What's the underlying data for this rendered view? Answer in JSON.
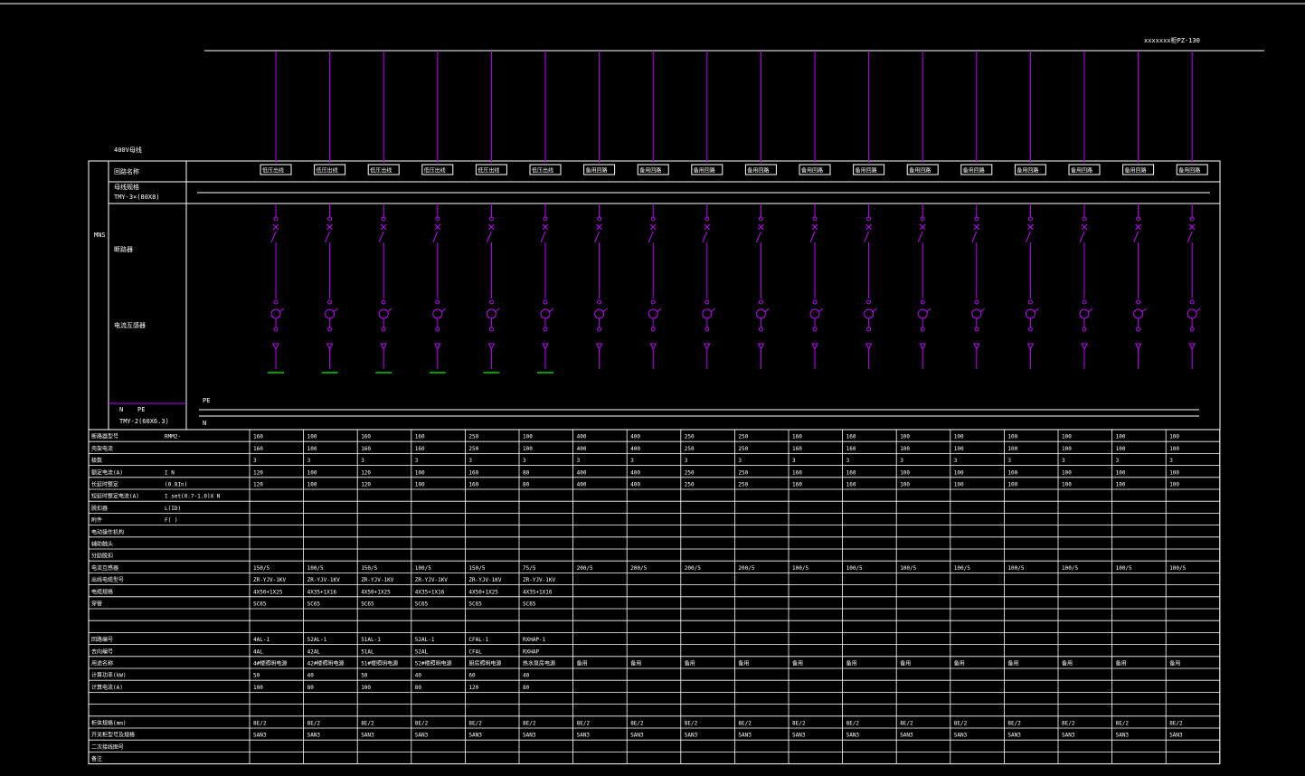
{
  "colors": {
    "background": "#000000",
    "lines": "#ffffff",
    "circuit": "#c000ff",
    "ground": "#00d000"
  },
  "header_note": "xxxxxxx柜PZ-130",
  "busbar_label": "400V母线",
  "left_panel": {
    "title_vertical": "MNS",
    "row_circuit_name": "回路名称",
    "row_busbar": "母线规格",
    "busbar_spec": "TMY-3×(80X8)",
    "row_breaker": "断路器",
    "row_ct": "电流互感器",
    "neutral_labels": [
      "N",
      "PE"
    ],
    "neutral_spec": "TMY-2(60X6.3)",
    "pe_label": "PE",
    "n_label": "N"
  },
  "feeders": [
    {
      "name": "低压出线",
      "rated": "160",
      "frame": "160",
      "poles": "3",
      "ir": "120",
      "set": "120",
      "ct": "150/5",
      "cable": "ZR-YJV-1KV",
      "size": "4X50+1X25",
      "conduit": "SC65",
      "loop": "4AL-1",
      "dest": "4AL",
      "use": "4#楼照明电源",
      "pe": "50",
      "ic": "100",
      "model": "8E/2",
      "stype": "SAN3",
      "ground": true
    },
    {
      "name": "低压出线",
      "rated": "100",
      "frame": "100",
      "poles": "3",
      "ir": "100",
      "set": "100",
      "ct": "100/5",
      "cable": "ZR-YJV-1KV",
      "size": "4X35+1X16",
      "conduit": "SC65",
      "loop": "52AL-1",
      "dest": "42AL",
      "use": "42#楼照明电源",
      "pe": "40",
      "ic": "80",
      "model": "8E/2",
      "stype": "SAN3",
      "ground": true
    },
    {
      "name": "低压出线",
      "rated": "160",
      "frame": "160",
      "poles": "3",
      "ir": "120",
      "set": "120",
      "ct": "150/5",
      "cable": "ZR-YJV-1KV",
      "size": "4X50+1X25",
      "conduit": "SC65",
      "loop": "51AL-1",
      "dest": "51AL",
      "use": "51#楼照明电源",
      "pe": "50",
      "ic": "100",
      "model": "8E/2",
      "stype": "SAN3",
      "ground": true
    },
    {
      "name": "低压出线",
      "rated": "160",
      "frame": "160",
      "poles": "3",
      "ir": "100",
      "set": "100",
      "ct": "100/5",
      "cable": "ZR-YJV-1KV",
      "size": "4X35+1X16",
      "conduit": "SC65",
      "loop": "52AL-1",
      "dest": "52AL",
      "use": "52#楼照明电源",
      "pe": "40",
      "ic": "80",
      "model": "8E/2",
      "stype": "SAN3",
      "ground": true
    },
    {
      "name": "低压出线",
      "rated": "250",
      "frame": "250",
      "poles": "3",
      "ir": "160",
      "set": "160",
      "ct": "150/5",
      "cable": "ZR-YJV-1KV",
      "size": "4X50+1X25",
      "conduit": "SC65",
      "loop": "CFAL-1",
      "dest": "CFAL",
      "use": "厨房照明电源",
      "pe": "60",
      "ic": "120",
      "model": "8E/2",
      "stype": "SAN3",
      "ground": true
    },
    {
      "name": "低压出线",
      "rated": "100",
      "frame": "100",
      "poles": "3",
      "ir": "80",
      "set": "80",
      "ct": "75/5",
      "cable": "ZR-YJV-1KV",
      "size": "4X35+1X16",
      "conduit": "SC65",
      "loop": "RXHAP-1",
      "dest": "RXHAP",
      "use": "热水泵房电源",
      "pe": "40",
      "ic": "80",
      "model": "8E/2",
      "stype": "SAN3",
      "ground": true
    },
    {
      "name": "备用回路",
      "rated": "400",
      "frame": "400",
      "poles": "3",
      "ir": "400",
      "set": "400",
      "ct": "200/5",
      "cable": "",
      "size": "",
      "conduit": "",
      "loop": "",
      "dest": "",
      "use": "备用",
      "pe": "",
      "ic": "",
      "model": "8E/2",
      "stype": "SAN3",
      "ground": false
    },
    {
      "name": "备用回路",
      "rated": "400",
      "frame": "400",
      "poles": "3",
      "ir": "400",
      "set": "400",
      "ct": "200/5",
      "cable": "",
      "size": "",
      "conduit": "",
      "loop": "",
      "dest": "",
      "use": "备用",
      "pe": "",
      "ic": "",
      "model": "8E/2",
      "stype": "SAN3",
      "ground": false
    },
    {
      "name": "备用回路",
      "rated": "250",
      "frame": "250",
      "poles": "3",
      "ir": "250",
      "set": "250",
      "ct": "200/5",
      "cable": "",
      "size": "",
      "conduit": "",
      "loop": "",
      "dest": "",
      "use": "备用",
      "pe": "",
      "ic": "",
      "model": "8E/2",
      "stype": "SAN3",
      "ground": false
    },
    {
      "name": "备用回路",
      "rated": "250",
      "frame": "250",
      "poles": "3",
      "ir": "250",
      "set": "250",
      "ct": "200/5",
      "cable": "",
      "size": "",
      "conduit": "",
      "loop": "",
      "dest": "",
      "use": "备用",
      "pe": "",
      "ic": "",
      "model": "8E/2",
      "stype": "SAN3",
      "ground": false
    },
    {
      "name": "备用回路",
      "rated": "160",
      "frame": "160",
      "poles": "3",
      "ir": "160",
      "set": "160",
      "ct": "100/5",
      "cable": "",
      "size": "",
      "conduit": "",
      "loop": "",
      "dest": "",
      "use": "备用",
      "pe": "",
      "ic": "",
      "model": "8E/2",
      "stype": "SAN3",
      "ground": false
    },
    {
      "name": "备用回路",
      "rated": "160",
      "frame": "160",
      "poles": "3",
      "ir": "160",
      "set": "160",
      "ct": "100/5",
      "cable": "",
      "size": "",
      "conduit": "",
      "loop": "",
      "dest": "",
      "use": "备用",
      "pe": "",
      "ic": "",
      "model": "8E/2",
      "stype": "SAN3",
      "ground": false
    },
    {
      "name": "备用回路",
      "rated": "100",
      "frame": "100",
      "poles": "3",
      "ir": "100",
      "set": "100",
      "ct": "100/5",
      "cable": "",
      "size": "",
      "conduit": "",
      "loop": "",
      "dest": "",
      "use": "备用",
      "pe": "",
      "ic": "",
      "model": "8E/2",
      "stype": "SAN3",
      "ground": false
    },
    {
      "name": "备用回路",
      "rated": "100",
      "frame": "100",
      "poles": "3",
      "ir": "100",
      "set": "100",
      "ct": "100/5",
      "cable": "",
      "size": "",
      "conduit": "",
      "loop": "",
      "dest": "",
      "use": "备用",
      "pe": "",
      "ic": "",
      "model": "8E/2",
      "stype": "SAN3",
      "ground": false
    },
    {
      "name": "备用回路",
      "rated": "100",
      "frame": "100",
      "poles": "3",
      "ir": "100",
      "set": "100",
      "ct": "100/5",
      "cable": "",
      "size": "",
      "conduit": "",
      "loop": "",
      "dest": "",
      "use": "备用",
      "pe": "",
      "ic": "",
      "model": "8E/2",
      "stype": "SAN3",
      "ground": false
    },
    {
      "name": "备用回路",
      "rated": "100",
      "frame": "100",
      "poles": "3",
      "ir": "100",
      "set": "100",
      "ct": "100/5",
      "cable": "",
      "size": "",
      "conduit": "",
      "loop": "",
      "dest": "",
      "use": "备用",
      "pe": "",
      "ic": "",
      "model": "8E/2",
      "stype": "SAN3",
      "ground": false
    },
    {
      "name": "备用回路",
      "rated": "100",
      "frame": "100",
      "poles": "3",
      "ir": "100",
      "set": "100",
      "ct": "100/5",
      "cable": "",
      "size": "",
      "conduit": "",
      "loop": "",
      "dest": "",
      "use": "备用",
      "pe": "",
      "ic": "",
      "model": "8E/2",
      "stype": "SAN3",
      "ground": false
    },
    {
      "name": "备用回路",
      "rated": "100",
      "frame": "100",
      "poles": "3",
      "ir": "100",
      "set": "100",
      "ct": "100/5",
      "cable": "",
      "size": "",
      "conduit": "",
      "loop": "",
      "dest": "",
      "use": "备用",
      "pe": "",
      "ic": "",
      "model": "8E/2",
      "stype": "SAN3",
      "ground": false
    }
  ],
  "table_rows": [
    {
      "label": "断路器型号",
      "sub": "RMM2-",
      "key": "rated"
    },
    {
      "label": "壳架电流",
      "sub": "",
      "key": "frame"
    },
    {
      "label": "极数",
      "sub": "",
      "key": "poles"
    },
    {
      "label": "额定电流(A)",
      "sub": "I N",
      "key": "ir"
    },
    {
      "label": "长延时整定",
      "sub": "(0.8In)",
      "key": "set"
    },
    {
      "label": "短延时整定电流(A)",
      "sub": "I set(0.7-1.0)X  N",
      "key": null
    },
    {
      "label": "脱扣器",
      "sub": "L(ID)",
      "key": null
    },
    {
      "label": "附件",
      "sub": "F( )",
      "key": null
    },
    {
      "label": "电动操作机构",
      "sub": "",
      "key": null
    },
    {
      "label": "辅助触头",
      "sub": "",
      "key": null
    },
    {
      "label": "分励脱扣",
      "sub": "",
      "key": null
    },
    {
      "label": "电流互感器",
      "sub": "",
      "key": "ct"
    },
    {
      "label": "出线电缆型号",
      "sub": "",
      "key": "cable"
    },
    {
      "label": "电缆规格",
      "sub": "",
      "key": "size"
    },
    {
      "label": "穿管",
      "sub": "",
      "key": "conduit"
    },
    {
      "label": "",
      "sub": "",
      "key": null
    },
    {
      "label": "",
      "sub": "",
      "key": null
    },
    {
      "label": "回路编号",
      "sub": "",
      "key": "loop"
    },
    {
      "label": "去向编号",
      "sub": "",
      "key": "dest"
    },
    {
      "label": "用途名称",
      "sub": "",
      "key": "use"
    },
    {
      "label": "计算功率(kW)",
      "sub": "",
      "key": "pe"
    },
    {
      "label": "计算电流(A)",
      "sub": "",
      "key": "ic"
    },
    {
      "label": "",
      "sub": "",
      "key": null
    },
    {
      "label": "",
      "sub": "",
      "key": null
    },
    {
      "label": "柜体规格(mm)",
      "sub": "",
      "key": "model"
    },
    {
      "label": "开关柜型号及规格",
      "sub": "",
      "key": "stype"
    },
    {
      "label": "二次接线图号",
      "sub": "",
      "key": null
    },
    {
      "label": "备注",
      "sub": "",
      "key": null
    }
  ]
}
